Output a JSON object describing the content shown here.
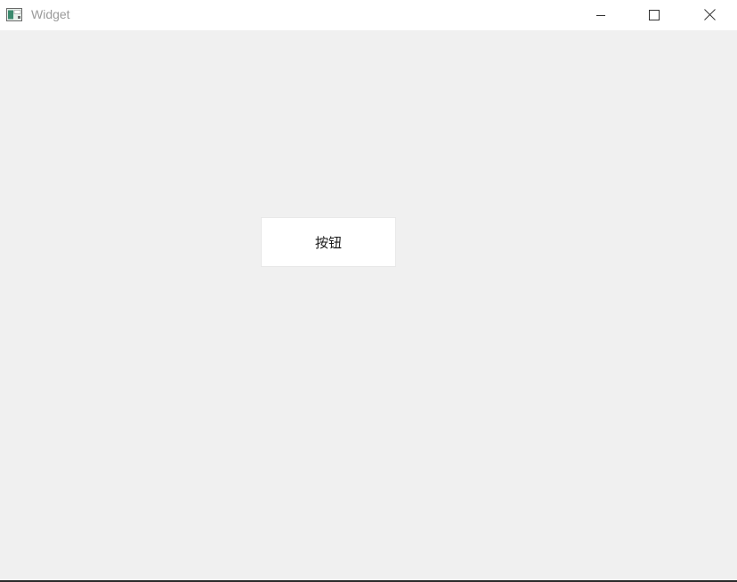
{
  "window": {
    "title": "Widget"
  },
  "icons": {
    "app": "app-window-icon",
    "minimize": "minimize-icon",
    "maximize": "maximize-icon",
    "close": "close-icon"
  },
  "main": {
    "button_label": "按钮"
  },
  "colors": {
    "titlebar": "#ffffff",
    "client": "#f0f0f0",
    "title_text": "#9a9a9a",
    "button_bg": "#ffffff"
  }
}
